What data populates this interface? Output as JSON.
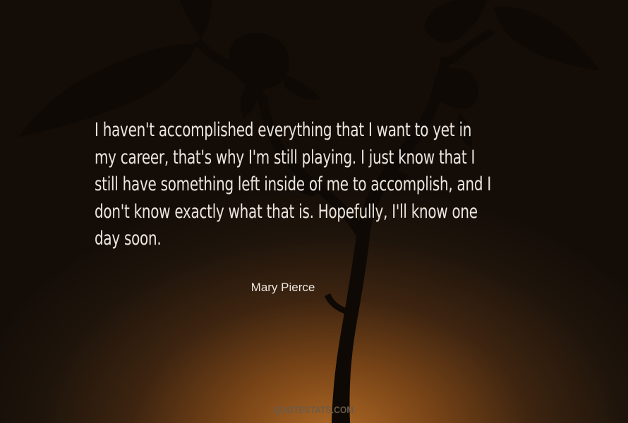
{
  "quote": {
    "lines": [
      "I haven't accomplished everything that I want to yet in",
      "my career, that's why I'm still playing. I just know that I",
      "still have something left inside of me to accomplish, and I",
      "don't know exactly what that is. Hopefully, I'll know one",
      "day soon."
    ]
  },
  "author": "Mary Pierce",
  "brand": "QUOTESTATS.COM",
  "colors": {
    "text": "#ece6df",
    "glow": "#b06a26",
    "background": "#1a120b",
    "silhouette": "#0e0905"
  }
}
